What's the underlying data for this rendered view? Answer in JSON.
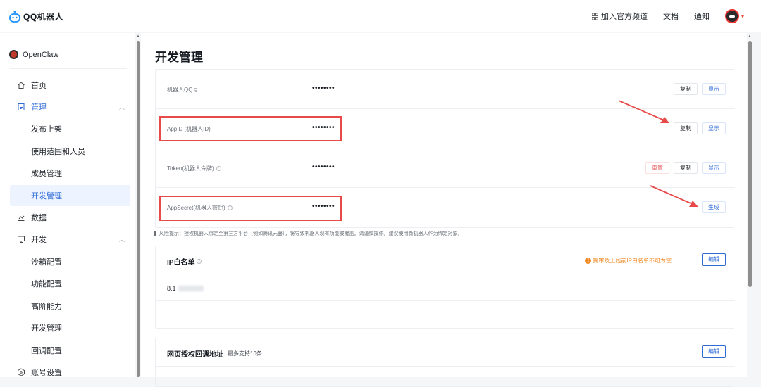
{
  "app": {
    "logo_text": "QQ机器人"
  },
  "topnav": {
    "join_channel": "加入官方频道",
    "docs": "文档",
    "notify": "通知"
  },
  "sidebar": {
    "bot_name": "OpenClaw",
    "items": [
      {
        "label": "首页",
        "icon": "home-icon"
      },
      {
        "label": "管理",
        "icon": "doc-icon"
      },
      {
        "label": "发布上架"
      },
      {
        "label": "使用范围和人员"
      },
      {
        "label": "成员管理"
      },
      {
        "label": "开发管理"
      },
      {
        "label": "数据",
        "icon": "chart-icon"
      },
      {
        "label": "开发",
        "icon": "monitor-icon"
      },
      {
        "label": "沙箱配置"
      },
      {
        "label": "功能配置"
      },
      {
        "label": "高阶能力"
      },
      {
        "label": "开发管理"
      },
      {
        "label": "回调配置"
      },
      {
        "label": "账号设置",
        "icon": "hex-icon"
      }
    ]
  },
  "main": {
    "title": "开发管理",
    "credentials": [
      {
        "label": "机器人QQ号",
        "value": "••••••••",
        "buttons": [
          "复制",
          "显示"
        ]
      },
      {
        "label": "AppID (机器人ID)",
        "value": "••••••••",
        "buttons": [
          "复制",
          "显示"
        ]
      },
      {
        "label": "Token(机器人令牌)",
        "value": "••••••••",
        "buttons": [
          "重置",
          "复制",
          "显示"
        ]
      },
      {
        "label": "AppSecret(机器人密钥)",
        "value": "••••••••",
        "buttons": [
          "生成"
        ]
      }
    ],
    "risk_note": "风险提示：授权机器人绑定至第三方平台（例如腾讯元器），将导致机器人现有功能被覆盖。请谨慎操作。建议使用新机器人作为绑定对象。",
    "ip_whitelist": {
      "title": "IP白名单",
      "warning": "提审及上线前IP白名单不可为空",
      "edit": "编辑",
      "ip_prefix": "8.1"
    },
    "callback": {
      "title": "网页授权回调地址",
      "subtitle": "最多支持10条",
      "edit": "编辑"
    }
  },
  "colors": {
    "accent": "#2d6ad6",
    "highlight": "#e84a4a",
    "warning": "#f08a24",
    "danger": "#e34d4d"
  }
}
